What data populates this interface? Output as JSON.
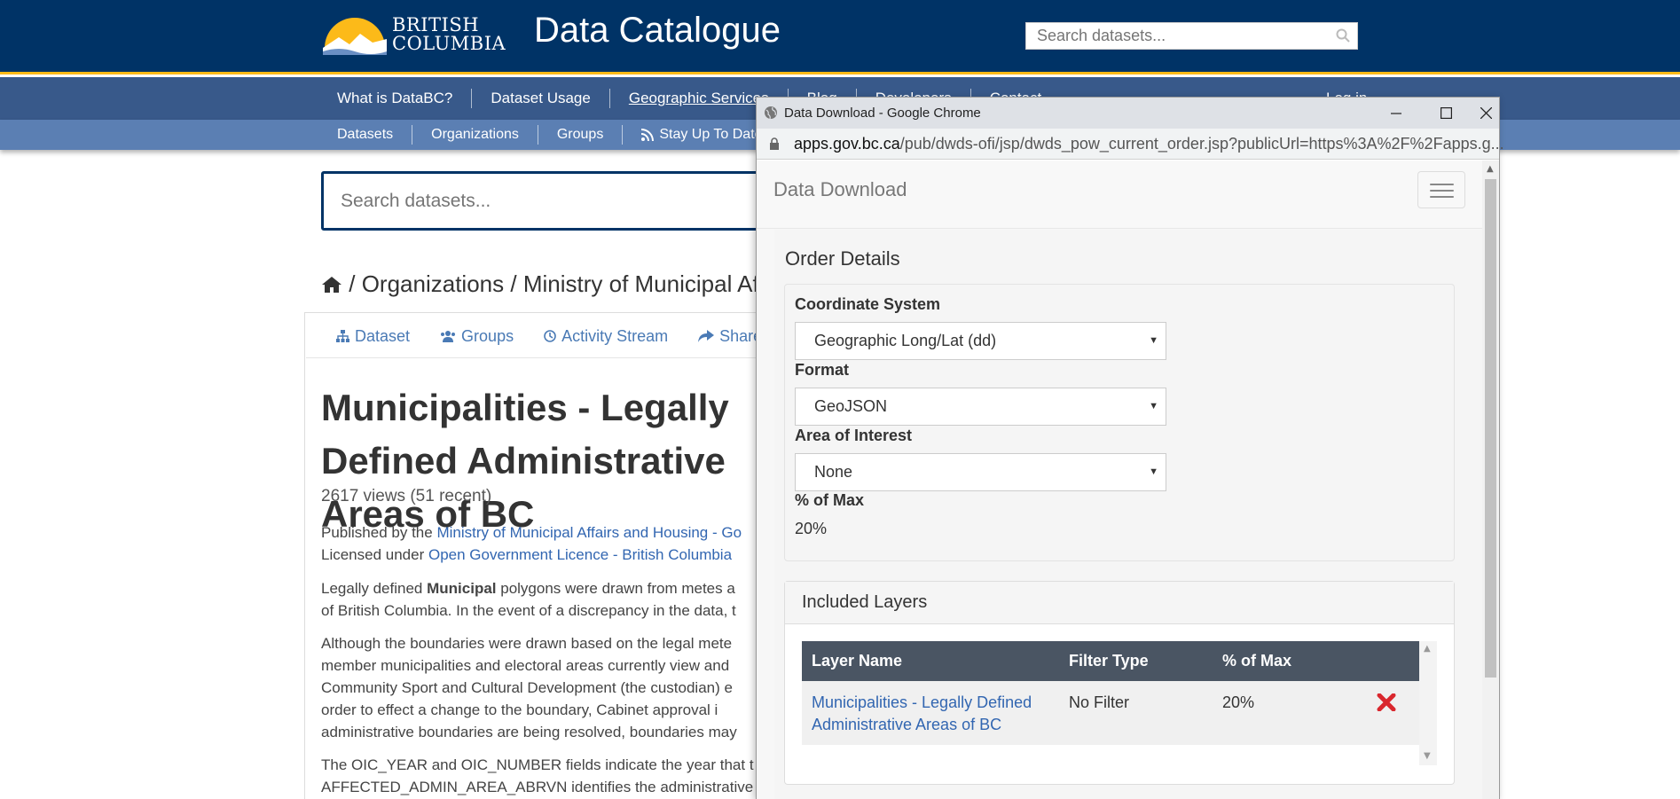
{
  "header": {
    "logo_line1": "BRITISH",
    "logo_line2": "COLUMBIA",
    "title": "Data Catalogue",
    "search_placeholder": "Search datasets..."
  },
  "nav_primary": [
    "What is DataBC?",
    "Dataset Usage",
    "Geographic Services",
    "Blog",
    "Developers",
    "Contact"
  ],
  "login_label": "Log in",
  "nav_secondary": [
    "Datasets",
    "Organizations",
    "Groups",
    "Stay Up To Date"
  ],
  "main_search_placeholder": "Search datasets...",
  "breadcrumb": {
    "sep1": "/",
    "organizations": "Organizations",
    "sep2": "/",
    "org": "Ministry of Municipal Affairs and Housing"
  },
  "tabs": [
    "Dataset",
    "Groups",
    "Activity Stream",
    "Share"
  ],
  "dataset": {
    "title": "Municipalities - Legally Defined Administrative Areas of BC",
    "views": "2617 views (51 recent)",
    "published_prefix": "Published by the",
    "publisher": "Ministry of Municipal Affairs and Housing - Go",
    "licensed_prefix": "Licensed under",
    "licence": "Open Government Licence - British Columbia",
    "desc1_a": "Legally defined",
    "desc1_bold": "Municipal",
    "desc1_b": "polygons were drawn from metes a",
    "desc1_line2": "of British Columbia. In the event of a discrepancy in the data, t",
    "desc2": [
      "Although the boundaries were drawn based on the legal mete",
      "member municipalities and electoral areas currently view and",
      "Community Sport and Cultural Development (the custodian) e",
      "order to effect a change to the boundary, Cabinet approval i",
      "administrative boundaries are being resolved, boundaries may"
    ],
    "desc3": [
      "The OIC_YEAR and OIC_NUMBER fields indicate the year that t",
      "AFFECTED_ADMIN_AREA_ABRVN identifies the administrative a"
    ]
  },
  "popup": {
    "window_title": "Data Download - Google Chrome",
    "url_host": "apps.gov.bc.ca",
    "url_path": "/pub/dwds-ofi/jsp/dwds_pow_current_order.jsp?publicUrl=https%3A%2F%2Fapps.g...",
    "brand": "Data Download",
    "order_title": "Order Details",
    "coord_label": "Coordinate System",
    "coord_value": "Geographic Long/Lat (dd)",
    "format_label": "Format",
    "format_value": "GeoJSON",
    "aoi_label": "Area of Interest",
    "aoi_value": "None",
    "pct_label": "% of Max",
    "pct_value": "20%",
    "layers_title": "Included Layers",
    "columns": [
      "Layer Name",
      "Filter Type",
      "% of Max"
    ],
    "rows": [
      {
        "layer_line1": "Municipalities - Legally Defined",
        "layer_line2": "Administrative Areas of BC",
        "filter": "No Filter",
        "pct": "20%"
      }
    ]
  },
  "colors": {
    "header_bg": "#003366",
    "accent_gold": "#fcba19",
    "nav1_bg": "#38598a",
    "nav2_bg": "#5b7fb3",
    "link": "#3266b1",
    "table_head": "#4a5563",
    "remove_x": "#d9272e"
  }
}
